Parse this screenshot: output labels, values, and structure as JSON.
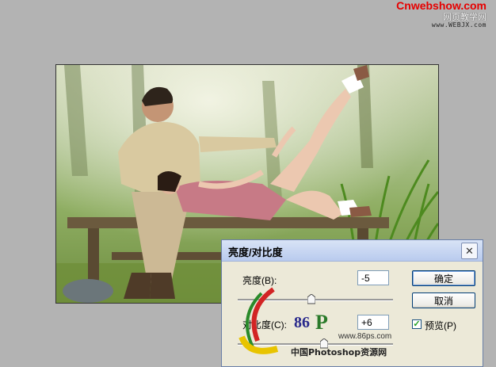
{
  "watermark": {
    "brand": "Cnwebshow.com",
    "chinese": "网页教学网",
    "url": "www.WEBJX.com"
  },
  "dialog": {
    "title": "亮度/对比度",
    "brightness": {
      "label": "亮度(B):",
      "value": "-5"
    },
    "contrast": {
      "label": "对比度(C):",
      "value": "+6"
    },
    "ok_label": "确定",
    "cancel_label": "取消",
    "preview": {
      "label": "预览(P)",
      "checked": true
    }
  },
  "overlay_logo": {
    "number": "86",
    "letter": "P",
    "url": "www.86ps.com",
    "chinese": "中国Photoshop资源网"
  }
}
